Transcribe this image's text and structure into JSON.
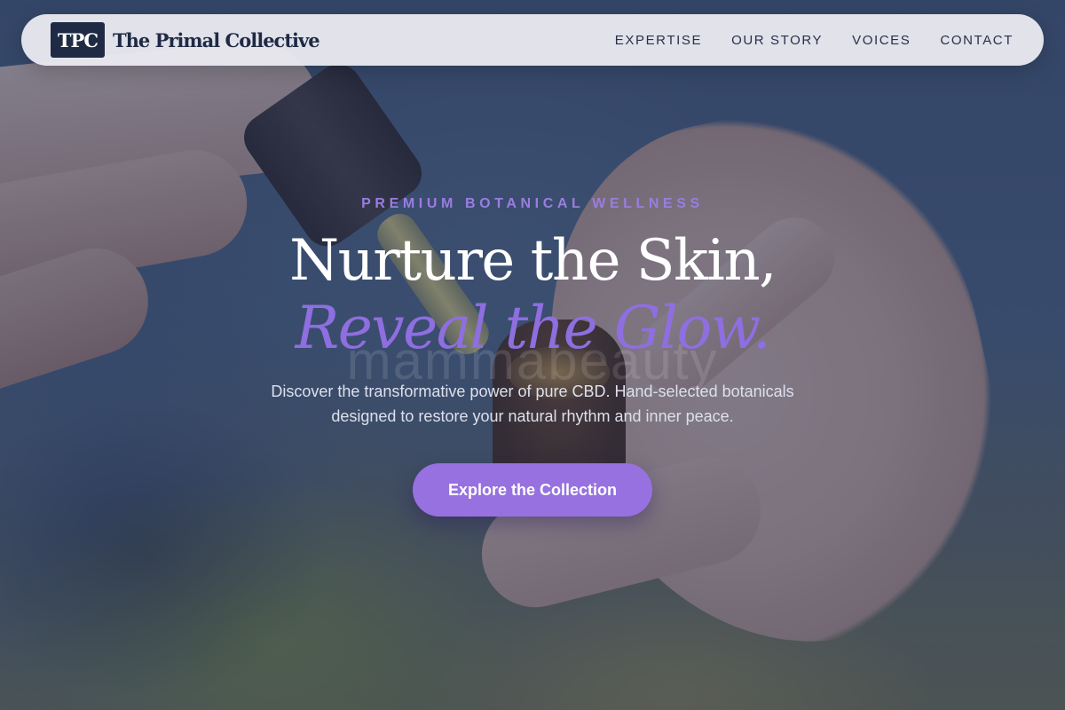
{
  "brand": {
    "mark": "TPC",
    "name": "The Primal Collective"
  },
  "nav": {
    "links": [
      "EXPERTISE",
      "OUR STORY",
      "VOICES",
      "CONTACT"
    ]
  },
  "hero": {
    "eyebrow": "PREMIUM BOTANICAL WELLNESS",
    "headline": "Nurture the Skin,",
    "headline_accent": "Reveal the Glow.",
    "watermark": "mammabeauty",
    "description": "Discover the transformative power of pure CBD. Hand-selected botanicals designed to restore your natural rhythm and inner peace.",
    "cta_label": "Explore the Collection"
  },
  "colors": {
    "accent": "#9771e0",
    "accent_text": "#9a7de0",
    "brand_navy": "#1f2a44",
    "nav_bg": "#ececf2",
    "overlay": "#303452"
  }
}
